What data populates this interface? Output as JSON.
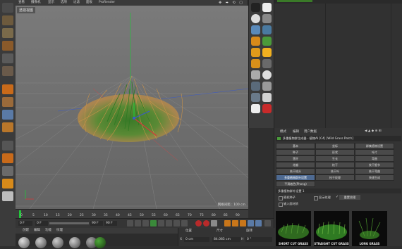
{
  "viewport": {
    "menu": [
      "查看",
      "摄像机",
      "显示",
      "选项",
      "过滤",
      "面板",
      "ProRender"
    ],
    "label": "透视视图",
    "grid_readout": "网格间距 : 100 cm",
    "nav_icons": "✥ ⬌ ⟲ ▢"
  },
  "timeline": {
    "ticks": [
      "0",
      "5",
      "10",
      "15",
      "20",
      "25",
      "30",
      "35",
      "40",
      "45",
      "50",
      "55",
      "60",
      "65",
      "70",
      "75",
      "80",
      "85",
      "90"
    ]
  },
  "transport": {
    "start_frame": "0 F",
    "current_frame": "0 F",
    "end_frame": "90 F",
    "max_frame": "90 F"
  },
  "bottom_menu": [
    "创建",
    "编辑",
    "功能",
    "纹理"
  ],
  "coords": {
    "headers": [
      "位置",
      "尺寸",
      "旋转"
    ],
    "x_pos": "0 cm",
    "x_size": "84.085 cm",
    "x_rot": "0 °",
    "x_label": "X",
    "h_label": "H"
  },
  "attributes": {
    "tabs": [
      "模式",
      "编辑",
      "用户数据"
    ],
    "nav": "◀ ▲ ◆ ⊕ ⊞",
    "object_title": "多重植物群生成器 - 植物AI [C4] [Wild Grass Patch]",
    "grid": [
      [
        "基本",
        "坐标",
        "群集植物设置"
      ],
      [
        "种子",
        "形状",
        "叶片"
      ],
      [
        "茎秆",
        "生长",
        "弯曲"
      ],
      [
        "花瓣",
        "枝干",
        "枝干细节"
      ],
      [
        "枝干结头",
        "枝干叶",
        "枝干弯曲"
      ],
      [
        "多重植物群外设置",
        "枝干纹理",
        "快速生成"
      ],
      [
        "平滑着色(Phong)",
        "",
        ""
      ]
    ],
    "selected_cell": "多重植物群外设置",
    "section_title": "多重植物群外设置 1",
    "option1": "随机种子",
    "option2": "显示纹理",
    "option3": "输入面材质",
    "apply_button": "重置纹理"
  },
  "presets": [
    {
      "label": "SHORT CUT GRASS"
    },
    {
      "label": "STRAIGHT CUT GRASS"
    },
    {
      "label": "LONG GRASS"
    }
  ],
  "colors": {
    "accent_blue": "#4e6a92",
    "grass_green": "#3f8a2f",
    "grass_tan": "#c9924a",
    "axis_green": "#22c53a",
    "axis_red": "#d23a3a"
  }
}
